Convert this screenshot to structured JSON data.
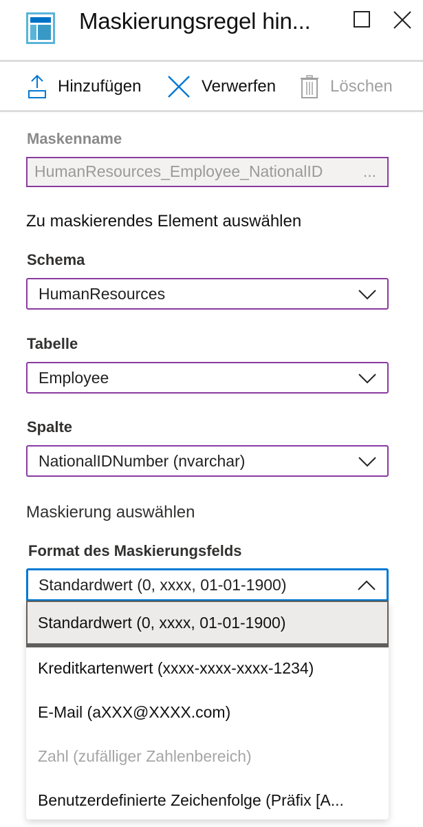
{
  "window": {
    "title": "Maskierungsregel hin...",
    "logo_icon": "blade-layout-icon",
    "maximize_icon": "maximize-icon",
    "close_icon": "close-icon"
  },
  "toolbar": {
    "add": {
      "label": "Hinzufügen",
      "icon": "upload-icon",
      "enabled": true
    },
    "discard": {
      "label": "Verwerfen",
      "icon": "x-icon",
      "enabled": true
    },
    "delete": {
      "label": "Löschen",
      "icon": "trash-icon",
      "enabled": false
    }
  },
  "form": {
    "mask_name": {
      "label": "Maskenname",
      "value": "HumanResources_Employee_NationalID",
      "overflow": "...",
      "disabled": true
    },
    "select_element_heading": "Zu maskierendes Element auswählen",
    "schema": {
      "label": "Schema",
      "value": "HumanResources"
    },
    "table": {
      "label": "Tabelle",
      "value": "Employee"
    },
    "column": {
      "label": "Spalte",
      "value": "NationalIDNumber (nvarchar)"
    },
    "select_mask_heading": "Maskierung auswählen",
    "mask_format": {
      "label": "Format des Maskierungsfelds",
      "value": "Standardwert (0, xxxx, 01-01-1900)",
      "expanded": true,
      "options": [
        {
          "label": "Standardwert (0, xxxx, 01-01-1900)",
          "selected": true,
          "disabled": false
        },
        {
          "label": "Kreditkartenwert (xxxx-xxxx-xxxx-1234)",
          "selected": false,
          "disabled": false
        },
        {
          "label": "E-Mail (aXXX@XXXX.com)",
          "selected": false,
          "disabled": false
        },
        {
          "label": "Zahl (zufälliger Zahlenbereich)",
          "selected": false,
          "disabled": true
        },
        {
          "label": "Benutzerdefinierte Zeichenfolge (Präfix [A...",
          "selected": false,
          "disabled": false
        }
      ]
    }
  },
  "colors": {
    "accent_blue": "#0078d4",
    "field_border_purple": "#8a3aa0",
    "disabled_text": "#a0a0a0",
    "selected_option_bg": "#edebe9"
  }
}
